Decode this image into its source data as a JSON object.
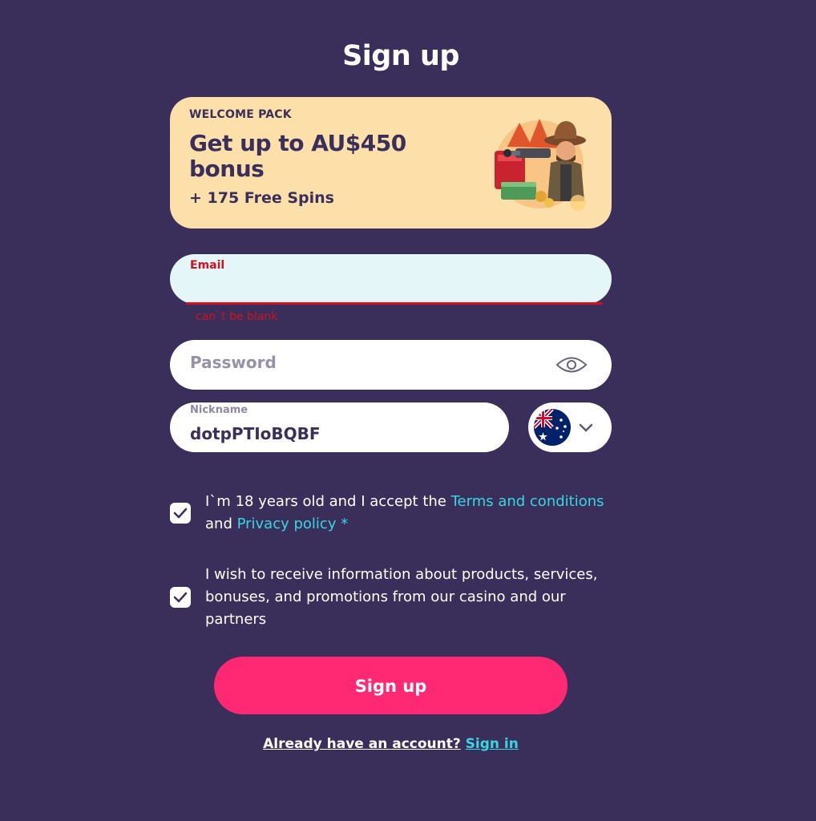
{
  "page": {
    "title": "Sign up"
  },
  "promo": {
    "label": "WELCOME PACK",
    "headline": "Get up to AU$450 bonus",
    "sub": "+ 175 Free Spins",
    "art_icon": "cowboy-bonus-illustration"
  },
  "form": {
    "email": {
      "label": "Email",
      "value": "",
      "error": "can`t be blank"
    },
    "password": {
      "placeholder": "Password",
      "toggle_icon": "eye-icon"
    },
    "nickname": {
      "label": "Nickname",
      "value": "dotpPTIoBQBF"
    },
    "country": {
      "flag_icon": "australia-flag-icon",
      "chevron_icon": "chevron-down-icon"
    },
    "consent_terms": {
      "checked": true,
      "text_before": "I`m 18 years old and I accept the ",
      "terms_link": "Terms and conditions",
      "text_mid": " and ",
      "privacy_link": "Privacy policy *"
    },
    "consent_marketing": {
      "checked": true,
      "text": "I wish to receive information about products, services, bonuses, and promotions from our casino and our partners"
    },
    "submit_label": "Sign up"
  },
  "footer": {
    "question": "Already have an account?",
    "signin_link": "Sign in"
  },
  "colors": {
    "background": "#3a2f5b",
    "promo_bg": "#fddfaa",
    "accent_pink": "#ff2873",
    "link_cyan": "#38d6e0",
    "error_red": "#d01220"
  }
}
